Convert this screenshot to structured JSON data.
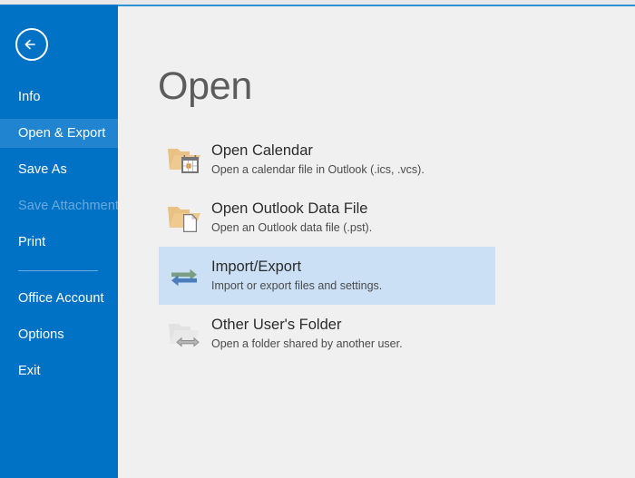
{
  "window": {
    "top_strip_color": "#e8e8e8",
    "accent_line_color": "#2a93d5",
    "redaction_box_color": "#c4c4c4"
  },
  "sidebar": {
    "background_color": "#0072c6",
    "selected_color": "#2184d0",
    "back_button": {
      "name": "back-button",
      "icon": "back-arrow-icon"
    },
    "items": [
      {
        "label": "Info",
        "state": "normal"
      },
      {
        "label": "Open & Export",
        "state": "selected"
      },
      {
        "label": "Save As",
        "state": "normal"
      },
      {
        "label": "Save Attachments",
        "state": "disabled"
      },
      {
        "label": "Print",
        "state": "normal"
      },
      {
        "label": "Office Account",
        "state": "normal"
      },
      {
        "label": "Options",
        "state": "normal"
      },
      {
        "label": "Exit",
        "state": "normal"
      }
    ]
  },
  "main": {
    "title": "Open",
    "highlight_color": "#cce0f5",
    "options": [
      {
        "title": "Open Calendar",
        "description": "Open a calendar file in Outlook (.ics, .vcs).",
        "icon": "folder-calendar-icon",
        "highlighted": false
      },
      {
        "title": "Open Outlook Data File",
        "description": "Open an Outlook data file (.pst).",
        "icon": "folder-document-icon",
        "highlighted": false
      },
      {
        "title": "Import/Export",
        "description": "Import or export files and settings.",
        "icon": "import-export-arrows-icon",
        "highlighted": true
      },
      {
        "title": "Other User's Folder",
        "description": "Open a folder shared by another user.",
        "icon": "folder-shared-icon",
        "highlighted": false
      }
    ]
  }
}
